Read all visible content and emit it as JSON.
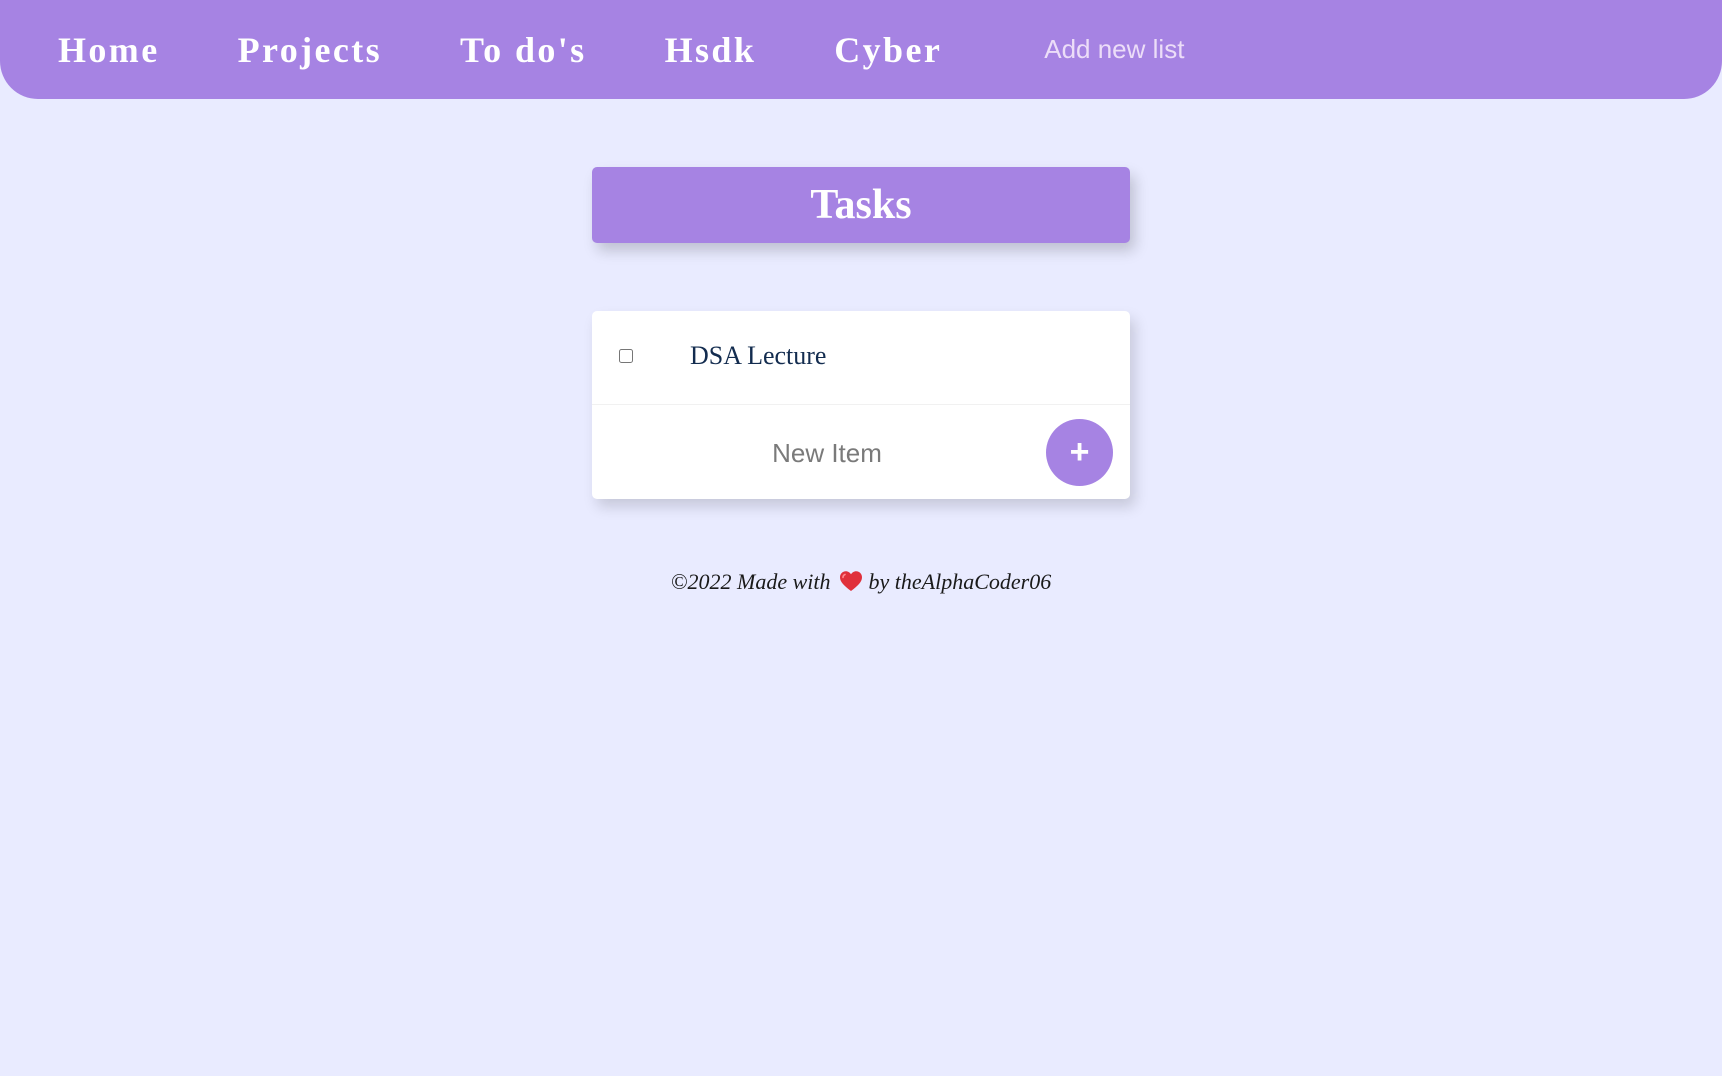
{
  "navbar": {
    "links": [
      {
        "label": "Home"
      },
      {
        "label": "Projects"
      },
      {
        "label": "To do's"
      },
      {
        "label": "Hsdk"
      },
      {
        "label": "Cyber"
      }
    ],
    "add_list_placeholder": "Add new list"
  },
  "heading": {
    "title": "Tasks"
  },
  "tasks": {
    "items": [
      {
        "label": "DSA Lecture",
        "checked": false
      }
    ],
    "new_item_placeholder": "New Item",
    "add_button_label": "+"
  },
  "footer": {
    "prefix": "©2022 Made with",
    "heart_icon": "heart-icon",
    "suffix": "by theAlphaCoder06"
  },
  "colors": {
    "accent": "#A683E3",
    "background": "#E9EBFF",
    "heart": "#E0303B"
  }
}
